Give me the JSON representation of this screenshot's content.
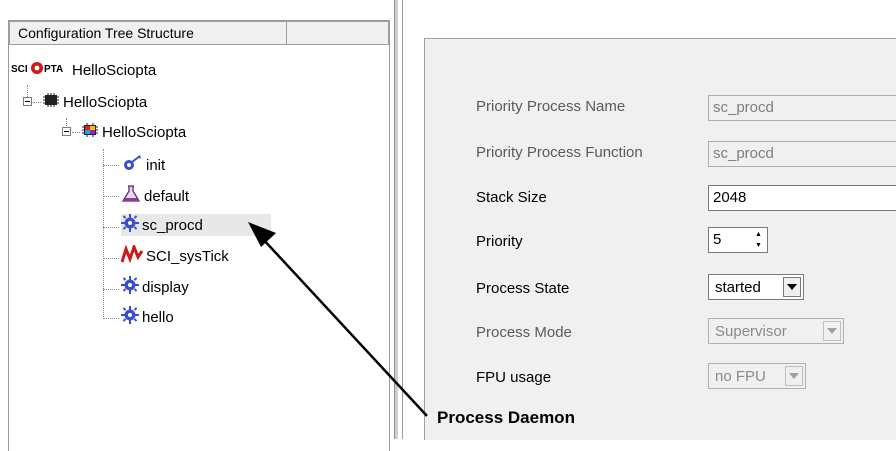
{
  "tree": {
    "header": {
      "col1": "Configuration Tree Structure",
      "col2": ""
    },
    "root": {
      "logo_text": "SCIOPTA",
      "label": "HelloSciopta"
    },
    "system": {
      "label": "HelloSciopta"
    },
    "module": {
      "label": "HelloSciopta"
    },
    "processes": [
      {
        "label": "init",
        "icon": "init-process-icon"
      },
      {
        "label": "default",
        "icon": "flask-icon"
      },
      {
        "label": "sc_procd",
        "icon": "gear-process-icon"
      },
      {
        "label": "SCI_sysTick",
        "icon": "interrupt-icon"
      },
      {
        "label": "display",
        "icon": "gear-process-icon"
      },
      {
        "label": "hello",
        "icon": "gear-process-icon"
      }
    ]
  },
  "config": {
    "priority_process_name": {
      "label": "Priority Process Name",
      "value": "sc_procd"
    },
    "priority_process_function": {
      "label": "Priority Process Function",
      "value": "sc_procd"
    },
    "stack_size": {
      "label": "Stack Size",
      "value": "2048"
    },
    "priority": {
      "label": "Priority",
      "value": "5"
    },
    "process_state": {
      "label": "Process State",
      "value": "started"
    },
    "process_mode": {
      "label": "Process Mode",
      "value": "Supervisor"
    },
    "fpu_usage": {
      "label": "FPU usage",
      "value": "no FPU"
    }
  },
  "annotation": {
    "text": "Process Daemon"
  },
  "colors": {
    "panel_bg": "#f0f0f0",
    "logo_red": "#d01818",
    "gear_blue": "#3a4fd0",
    "cpu_dark": "#222222"
  }
}
